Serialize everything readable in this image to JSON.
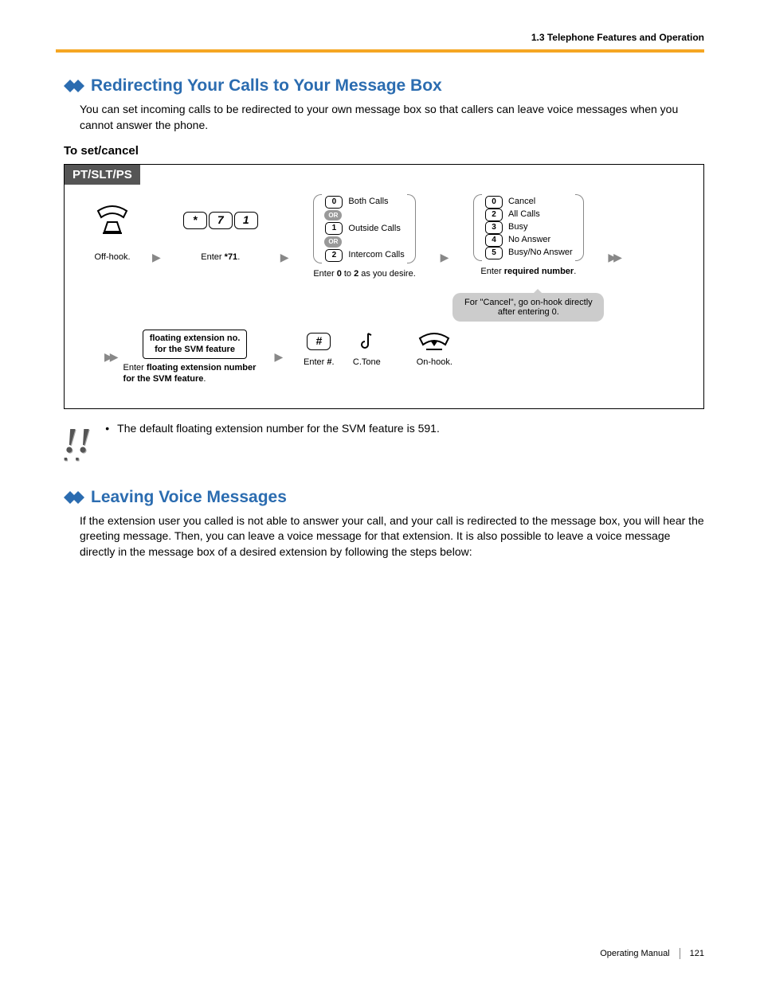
{
  "header": {
    "breadcrumb": "1.3 Telephone Features and Operation"
  },
  "section1": {
    "title": "Redirecting Your Calls to Your Message Box",
    "intro": "You can set incoming calls to be redirected to your own message box so that callers can leave voice messages when you cannot answer the phone.",
    "subhead": "To set/cancel"
  },
  "proc": {
    "tab": "PT/SLT/PS",
    "row1": {
      "offhook": "Off-hook.",
      "enter71_pre": "Enter ",
      "enter71_b": "71",
      "enter71_post": ".",
      "keys": [
        "*",
        "7",
        "1"
      ],
      "callTypes": {
        "k0": "0",
        "l0": "Both Calls",
        "or": "OR",
        "k1": "1",
        "l1": "Outside Calls",
        "k2": "2",
        "l2": "Intercom Calls",
        "cap_pre": "Enter ",
        "cap_b1": "0",
        "cap_mid": " to ",
        "cap_b2": "2",
        "cap_post": " as you desire."
      },
      "modes": {
        "k0": "0",
        "l0": "Cancel",
        "k2": "2",
        "l2": "All Calls",
        "k3": "3",
        "l3": "Busy",
        "k4": "4",
        "l4": "No Answer",
        "k5": "5",
        "l5": "Busy/No Answer",
        "cap_pre": "Enter ",
        "cap_b": "required number",
        "cap_post": "."
      },
      "callout": "For \"Cancel\", go on-hook directly after entering 0."
    },
    "row2": {
      "float_l1": "floating extension no.",
      "float_l2": "for the SVM feature",
      "float_cap_pre": "Enter ",
      "float_cap_b": "floating extension number for the SVM feature",
      "float_cap_post": ".",
      "hash": "#",
      "hash_cap_pre": "Enter ",
      "hash_cap_b": "#",
      "hash_cap_post": ".",
      "ctone": "C.Tone",
      "onhook": "On-hook."
    }
  },
  "note": {
    "bullet": "•",
    "text": "The default floating extension number for the SVM feature is 591."
  },
  "section2": {
    "title": "Leaving Voice Messages",
    "intro": "If the extension user you called is not able to answer your call, and your call is redirected to the message box, you will hear the greeting message. Then, you can leave a voice message for that extension. It is also possible to leave a voice message directly in the message box of a desired extension by following the steps below:"
  },
  "footer": {
    "manual": "Operating Manual",
    "page": "121"
  }
}
